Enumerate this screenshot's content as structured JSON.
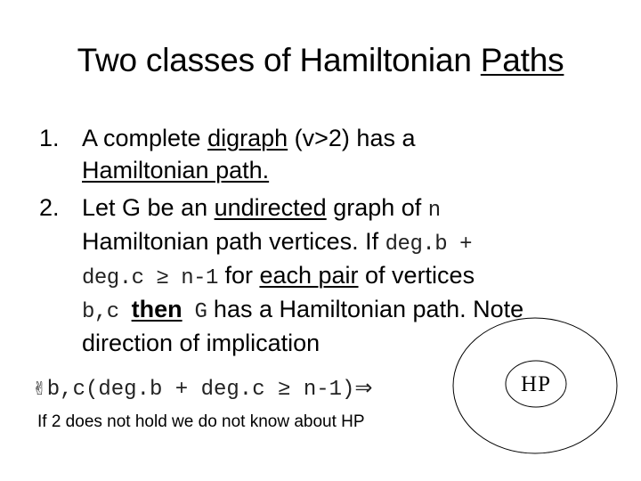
{
  "slide": {
    "title": {
      "prefix": "Two classes of Hamiltonian ",
      "underlined": "Paths"
    },
    "items": [
      {
        "number": "1.",
        "line1": {
          "t1": "A complete ",
          "u1": "digraph",
          "t2": " (v>2) has a"
        },
        "line2": {
          "u1": "Hamiltonian path."
        }
      },
      {
        "number": "2.",
        "line1": {
          "t1": "Let G be an ",
          "u1": "undirected",
          "t2": " graph of ",
          "m1": "n"
        },
        "line2": {
          "t1": "Hamiltonian path vertices. If ",
          "m1": "deg.b +"
        },
        "line3": {
          "m1": "deg.c ≥ n-1",
          "t1": " for ",
          "u1": "each pair",
          "t2": " of vertices"
        },
        "line4": {
          "m1": "b,c ",
          "u1": "then",
          "m2": " G",
          "t1": " has a Hamiltonian path. Note"
        },
        "line5": {
          "t1": "direction of implication"
        }
      }
    ],
    "formula": {
      "quantifier_glyph": "✌",
      "expression": "b,c(deg.b + deg.c ≥ n-1)",
      "implies": "⇒"
    },
    "note": "If 2 does not hold we do not know about HP",
    "diagram": {
      "inner_label": "HP",
      "stroke_color": "#000000"
    }
  }
}
